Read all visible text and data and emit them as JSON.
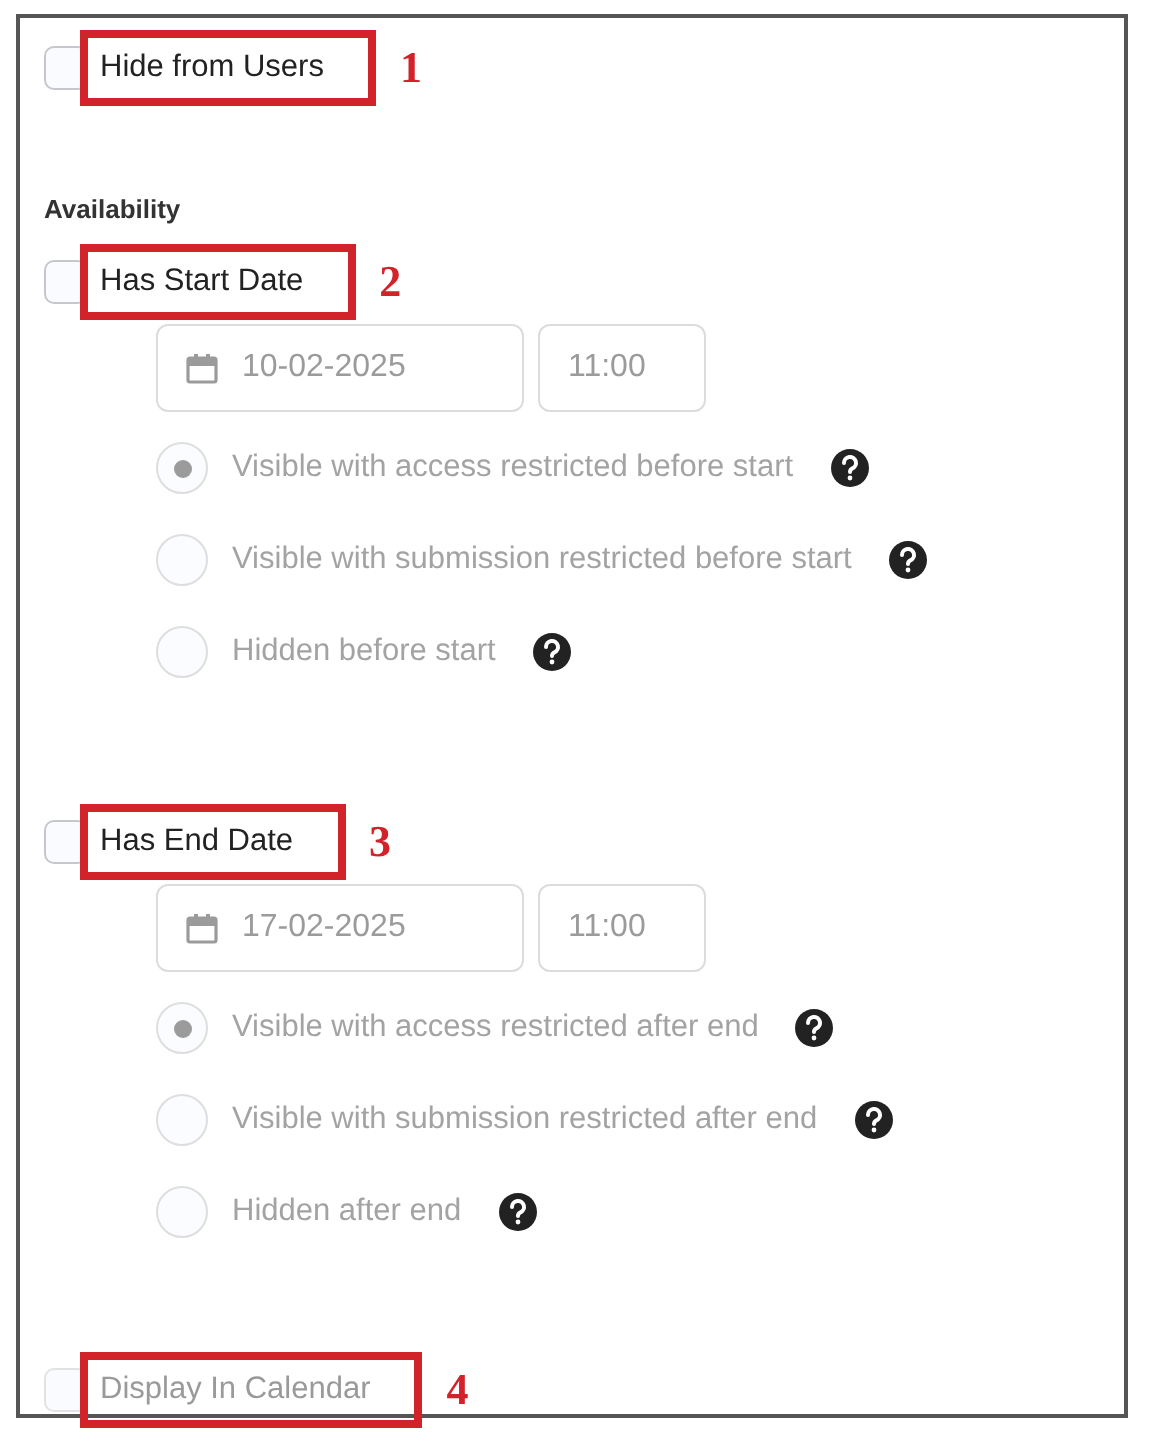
{
  "options": [
    {
      "kind": "checkbox",
      "label": "Hide from Users",
      "checked": false,
      "disabled": false,
      "callout": "1"
    },
    {
      "kind": "heading",
      "label": "Availability"
    },
    {
      "kind": "date_section",
      "label": "Has Start Date",
      "checked": false,
      "disabled": false,
      "callout": "2",
      "date": "10-02-2025",
      "time": "11:00",
      "fields_disabled": true,
      "choices": [
        {
          "label": "Visible with access restricted before start",
          "selected": true
        },
        {
          "label": "Visible with submission restricted before start",
          "selected": false
        },
        {
          "label": "Hidden before start",
          "selected": false
        }
      ]
    },
    {
      "kind": "date_section",
      "label": "Has End Date",
      "checked": false,
      "disabled": false,
      "callout": "3",
      "date": "17-02-2025",
      "time": "11:00",
      "fields_disabled": true,
      "choices": [
        {
          "label": "Visible with access restricted after end",
          "selected": true
        },
        {
          "label": "Visible with submission restricted after end",
          "selected": false
        },
        {
          "label": "Hidden after end",
          "selected": false
        }
      ]
    },
    {
      "kind": "checkbox",
      "label": "Display In Calendar",
      "checked": false,
      "disabled": true,
      "callout": "4"
    }
  ]
}
